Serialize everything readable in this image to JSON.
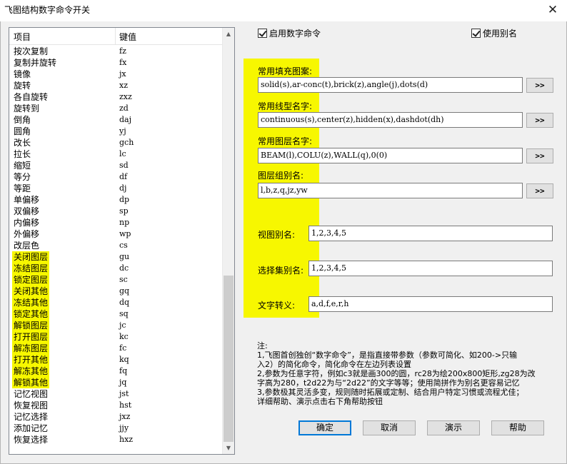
{
  "window": {
    "title": "飞图结构数字命令开关",
    "close_glyph": "✕"
  },
  "list": {
    "columns": [
      "项目",
      "键值"
    ],
    "rows": [
      {
        "name": "按次复制",
        "key": "fz",
        "highlight": false
      },
      {
        "name": "复制并旋转",
        "key": "fx",
        "highlight": false
      },
      {
        "name": "镜像",
        "key": "jx",
        "highlight": false
      },
      {
        "name": "旋转",
        "key": "xz",
        "highlight": false
      },
      {
        "name": "各自旋转",
        "key": "zxz",
        "highlight": false
      },
      {
        "name": "旋转到",
        "key": "zd",
        "highlight": false
      },
      {
        "name": "倒角",
        "key": "daj",
        "highlight": false
      },
      {
        "name": "圆角",
        "key": "yj",
        "highlight": false
      },
      {
        "name": "改长",
        "key": "gch",
        "highlight": false
      },
      {
        "name": "拉长",
        "key": "lc",
        "highlight": false
      },
      {
        "name": "缩短",
        "key": "sd",
        "highlight": false
      },
      {
        "name": "等分",
        "key": "df",
        "highlight": false
      },
      {
        "name": "等距",
        "key": "dj",
        "highlight": false
      },
      {
        "name": "单偏移",
        "key": "dp",
        "highlight": false
      },
      {
        "name": "双偏移",
        "key": "sp",
        "highlight": false
      },
      {
        "name": "内偏移",
        "key": "np",
        "highlight": false
      },
      {
        "name": "外偏移",
        "key": "wp",
        "highlight": false
      },
      {
        "name": "改层色",
        "key": "cs",
        "highlight": false
      },
      {
        "name": "关闭图层",
        "key": "gu",
        "highlight": true
      },
      {
        "name": "冻结图层",
        "key": "dc",
        "highlight": true
      },
      {
        "name": "锁定图层",
        "key": "sc",
        "highlight": true
      },
      {
        "name": "关闭其他",
        "key": "gq",
        "highlight": true
      },
      {
        "name": "冻结其他",
        "key": "dq",
        "highlight": true
      },
      {
        "name": "锁定其他",
        "key": "sq",
        "highlight": true
      },
      {
        "name": "解锁图层",
        "key": "jc",
        "highlight": true
      },
      {
        "name": "打开图层",
        "key": "kc",
        "highlight": true
      },
      {
        "name": "解冻图层",
        "key": "fc",
        "highlight": true
      },
      {
        "name": "打开其他",
        "key": "kq",
        "highlight": true
      },
      {
        "name": "解冻其他",
        "key": "fq",
        "highlight": true
      },
      {
        "name": "解锁其他",
        "key": "jq",
        "highlight": true
      },
      {
        "name": "记忆视图",
        "key": "jst",
        "highlight": false
      },
      {
        "name": "恢复视图",
        "key": "hst",
        "highlight": false
      },
      {
        "name": "记忆选择",
        "key": "jxz",
        "highlight": false
      },
      {
        "name": "添加记忆",
        "key": "jjy",
        "highlight": false
      },
      {
        "name": "恢复选择",
        "key": "hxz",
        "highlight": false
      }
    ]
  },
  "options": {
    "enable_numeric": {
      "label": "启用数字命令",
      "checked": true
    },
    "use_alias": {
      "label": "使用别名",
      "checked": true
    }
  },
  "fields": {
    "hatch": {
      "label": "常用填充图案:",
      "value": "solid(s),ar-conc(t),brick(z),angle(j),dots(d)"
    },
    "linetype": {
      "label": "常用线型名字:",
      "value": "continuous(s),center(z),hidden(x),dashdot(dh)"
    },
    "layer": {
      "label": "常用图层名字:",
      "value": "BEAM(l),COLU(z),WALL(q),0(0)"
    },
    "group": {
      "label": "图层组别名:",
      "value": "l,b,z,q,jz,yw"
    },
    "view_alias": {
      "label": "视图别名:",
      "value": "1,2,3,4,5"
    },
    "selset_alias": {
      "label": "选择集别名:",
      "value": "1,2,3,4,5"
    },
    "text_escape": {
      "label": "文字转义:",
      "value": "a,d,f,e,r,h"
    },
    "more_label": ">>"
  },
  "notes": [
    "注:",
    "1,飞图首创独创“数字命令”，是指直接带参数（参数可简化、如200->只输",
    "入2）的简化命令，简化命令在左边列表设置",
    "2,参数为任意字符，例如c3就是画300的圆，rc28为绘200x800矩形,zg28为改",
    "字高为280，t2d22为与“2d22”的文字等等；使用简拼作为别名更容易记忆",
    "3,参数极其灵活多变，规则随时拓展或定制、结合用户特定习惯或流程尤佳；",
    "详细帮助、演示点击右下角帮助按钮"
  ],
  "buttons": {
    "ok": "确定",
    "cancel": "取消",
    "demo": "演示",
    "help": "帮助"
  },
  "colors": {
    "highlight": "#f7f700",
    "focus_border": "#0078d7"
  }
}
